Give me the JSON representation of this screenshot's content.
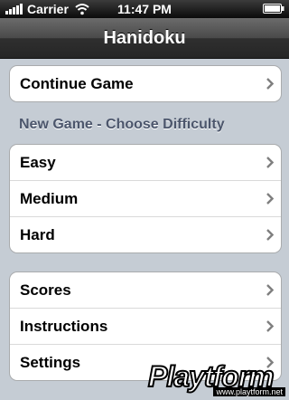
{
  "status_bar": {
    "carrier": "Carrier",
    "time": "11:47 PM"
  },
  "nav": {
    "title": "Hanidoku"
  },
  "group1": {
    "items": [
      {
        "label": "Continue Game"
      }
    ]
  },
  "section_new_game": {
    "header": "New Game - Choose Difficulty"
  },
  "group2": {
    "items": [
      {
        "label": "Easy"
      },
      {
        "label": "Medium"
      },
      {
        "label": "Hard"
      }
    ]
  },
  "group3": {
    "items": [
      {
        "label": "Scores"
      },
      {
        "label": "Instructions"
      },
      {
        "label": "Settings"
      }
    ]
  },
  "watermark": {
    "brand": "Playtform",
    "url": "www.playtform.net"
  },
  "icons": {
    "chevron": "chevron-right-icon",
    "wifi": "wifi-icon",
    "battery": "battery-icon",
    "signal": "signal-icon"
  }
}
